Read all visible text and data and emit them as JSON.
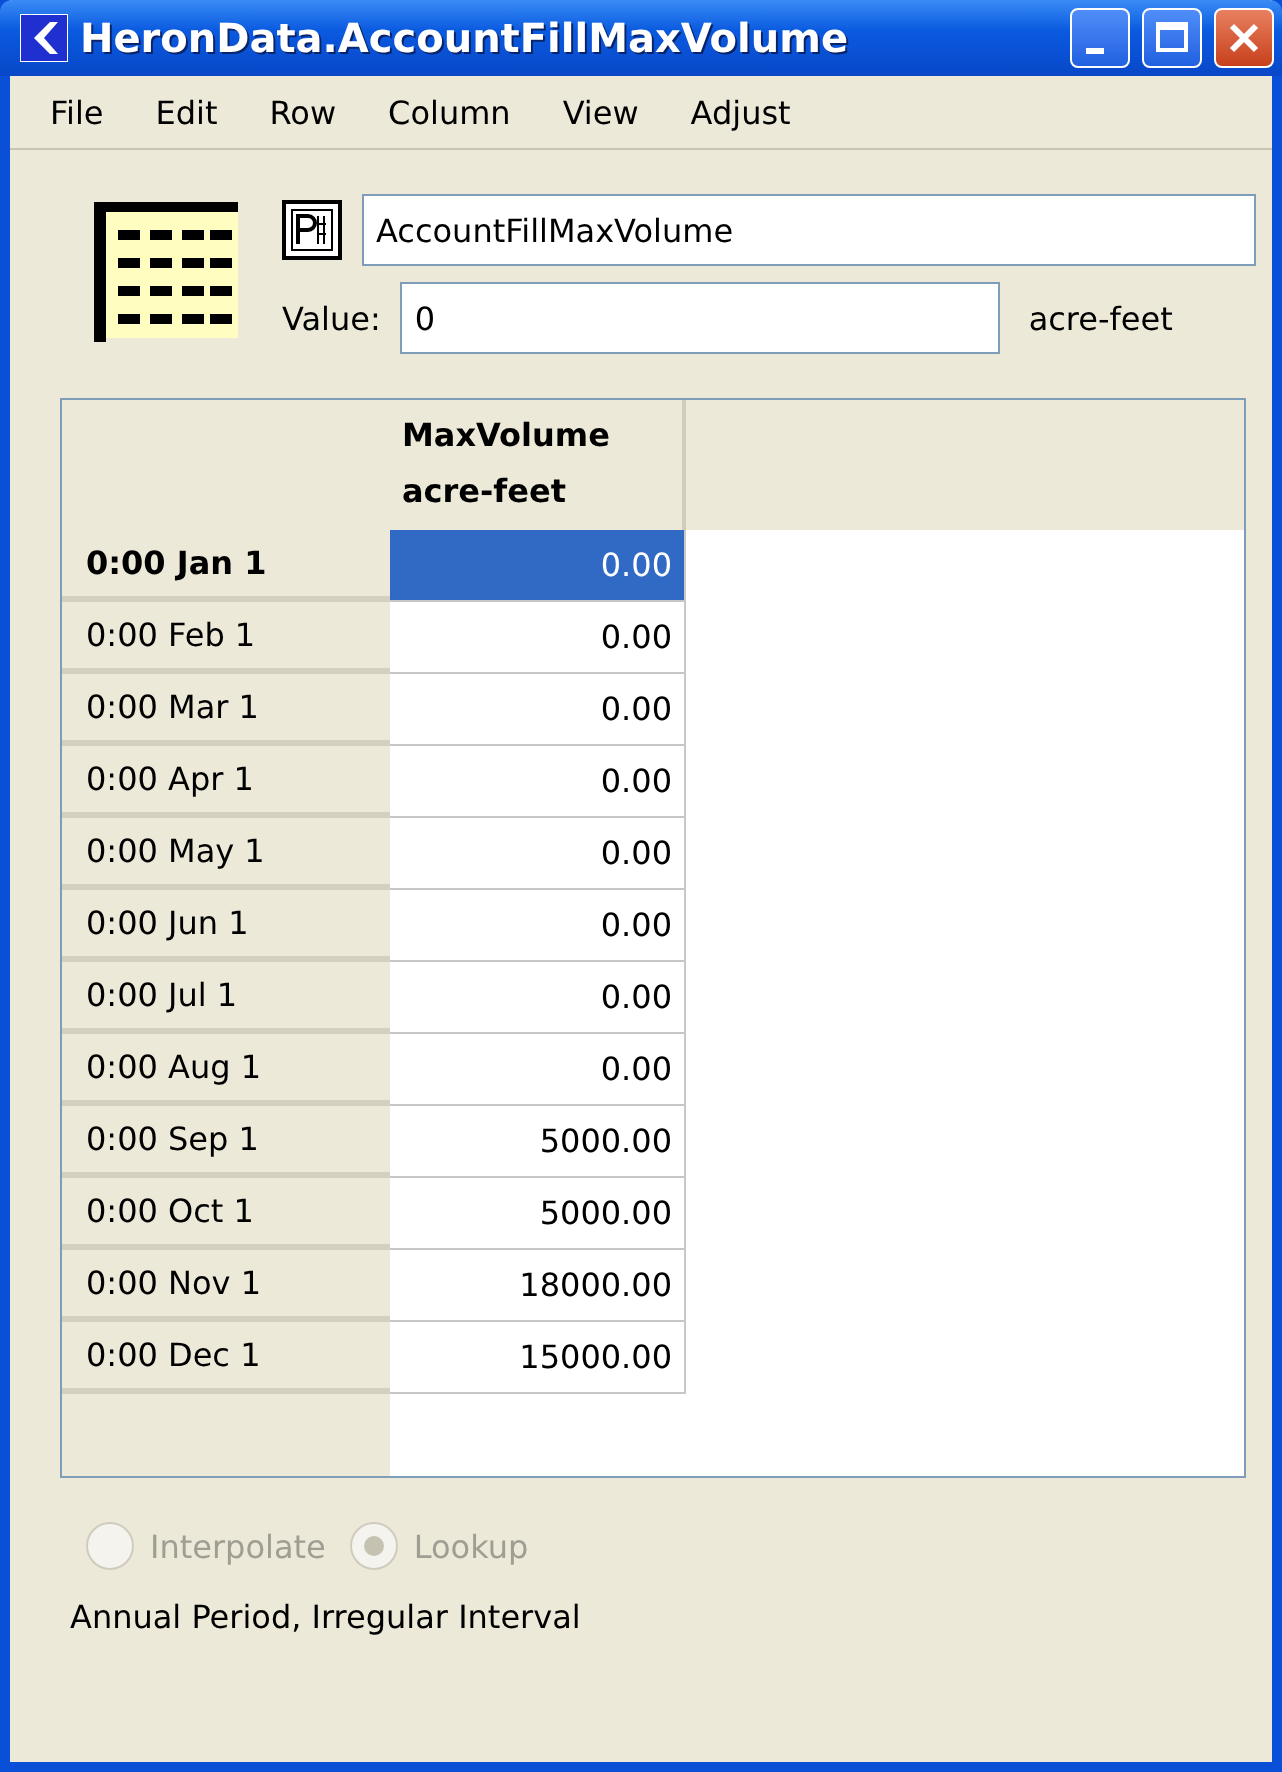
{
  "window": {
    "title": "HeronData.AccountFillMaxVolume"
  },
  "menu": [
    "File",
    "Edit",
    "Row",
    "Column",
    "View",
    "Adjust"
  ],
  "name_field": {
    "value": "AccountFillMaxVolume"
  },
  "value_field": {
    "label": "Value:",
    "value": "0",
    "units": "acre-feet"
  },
  "table": {
    "columns": [
      {
        "name": "MaxVolume",
        "units": "acre-feet"
      }
    ],
    "rows": [
      {
        "time": "0:00 Jan 1",
        "value": "0.00",
        "selected": true
      },
      {
        "time": "0:00 Feb 1",
        "value": "0.00",
        "selected": false
      },
      {
        "time": "0:00 Mar 1",
        "value": "0.00",
        "selected": false
      },
      {
        "time": "0:00 Apr 1",
        "value": "0.00",
        "selected": false
      },
      {
        "time": "0:00 May 1",
        "value": "0.00",
        "selected": false
      },
      {
        "time": "0:00 Jun 1",
        "value": "0.00",
        "selected": false
      },
      {
        "time": "0:00 Jul 1",
        "value": "0.00",
        "selected": false
      },
      {
        "time": "0:00 Aug 1",
        "value": "0.00",
        "selected": false
      },
      {
        "time": "0:00 Sep 1",
        "value": "5000.00",
        "selected": false
      },
      {
        "time": "0:00 Oct 1",
        "value": "5000.00",
        "selected": false
      },
      {
        "time": "0:00 Nov 1",
        "value": "18000.00",
        "selected": false
      },
      {
        "time": "0:00 Dec 1",
        "value": "15000.00",
        "selected": false
      }
    ]
  },
  "modes": [
    {
      "label": "Interpolate",
      "selected": false,
      "disabled": true
    },
    {
      "label": "Lookup",
      "selected": true,
      "disabled": true
    }
  ],
  "status": "Annual Period, Irregular Interval"
}
